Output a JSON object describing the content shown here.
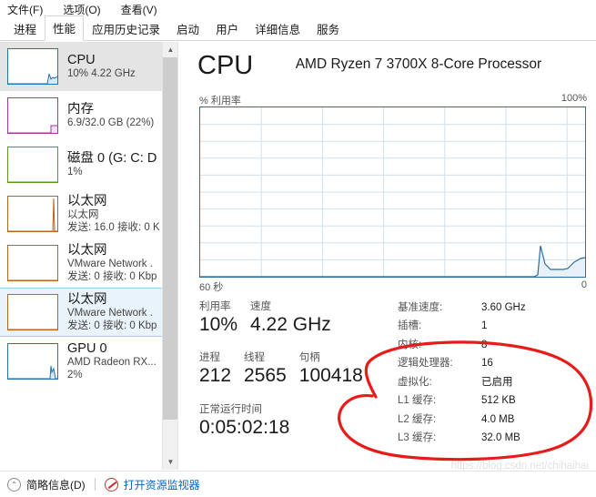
{
  "window": {
    "menu": [
      {
        "label": "文件(F)",
        "name": "menu-file"
      },
      {
        "label": "选项(O)",
        "name": "menu-options"
      },
      {
        "label": "查看(V)",
        "name": "menu-view"
      }
    ],
    "tabs": [
      {
        "label": "进程",
        "selected": false
      },
      {
        "label": "性能",
        "selected": true
      },
      {
        "label": "应用历史记录",
        "selected": false
      },
      {
        "label": "启动",
        "selected": false
      },
      {
        "label": "用户",
        "selected": false
      },
      {
        "label": "详细信息",
        "selected": false
      },
      {
        "label": "服务",
        "selected": false
      }
    ]
  },
  "sidebar": {
    "items": [
      {
        "title": "CPU",
        "sub1": "10% 4.22 GHz",
        "sub2": "",
        "color": "#2374ab",
        "state": "selected"
      },
      {
        "title": "内存",
        "sub1": "6.9/32.0 GB (22%)",
        "sub2": "",
        "color": "#a137a1",
        "state": "normal"
      },
      {
        "title": "磁盘 0 (G: C: D",
        "sub1": "1%",
        "sub2": "",
        "color": "#5b9822",
        "state": "normal"
      },
      {
        "title": "以太网",
        "sub1": "以太网",
        "sub2": "发送: 16.0 接收: 0 K",
        "color": "#b5651d",
        "state": "normal"
      },
      {
        "title": "以太网",
        "sub1": "VMware Network .",
        "sub2": "发送: 0 接收: 0 Kbp",
        "color": "#b5651d",
        "state": "normal"
      },
      {
        "title": "以太网",
        "sub1": "VMware Network .",
        "sub2": "发送: 0 接收: 0 Kbp",
        "color": "#b5651d",
        "state": "hover"
      },
      {
        "title": "GPU 0",
        "sub1": "AMD Radeon RX...",
        "sub2": "2%",
        "color": "#2374ab",
        "state": "normal"
      }
    ],
    "scrollbar": {
      "up": "▲",
      "down": "▼"
    }
  },
  "main": {
    "title": "CPU",
    "subtitle": "AMD Ryzen 7 3700X 8-Core Processor",
    "axis_label": "% 利用率",
    "axis_max": "100%",
    "time_left": "60 秒",
    "time_right": "0",
    "stats": {
      "row1": [
        {
          "label": "利用率",
          "value": "10%"
        },
        {
          "label": "速度",
          "value": "4.22 GHz"
        }
      ],
      "row2": [
        {
          "label": "进程",
          "value": "212"
        },
        {
          "label": "线程",
          "value": "2565"
        },
        {
          "label": "句柄",
          "value": "100418"
        }
      ],
      "row3": [
        {
          "label": "正常运行时间",
          "value": "0:05:02:18"
        }
      ]
    },
    "specs": [
      {
        "label": "基准速度:",
        "value": "3.60 GHz"
      },
      {
        "label": "插槽:",
        "value": "1"
      },
      {
        "label": "内核:",
        "value": "8"
      },
      {
        "label": "逻辑处理器:",
        "value": "16"
      },
      {
        "label": "虚拟化:",
        "value": "已启用"
      },
      {
        "label": "L1 缓存:",
        "value": "512 KB"
      },
      {
        "label": "L2 缓存:",
        "value": "4.0 MB"
      },
      {
        "label": "L3 缓存:",
        "value": "32.0 MB"
      }
    ]
  },
  "annotation": {
    "color": "#e81b1b"
  },
  "watermark": {
    "text": "https://blog.csdn.net/chihaihai"
  },
  "footer": {
    "summary_label": "简略信息(D)",
    "summary_chevron": "⌃",
    "resource_link": "打开资源监视器"
  },
  "chart_data": {
    "type": "area",
    "title": "CPU 利用率",
    "ylabel": "% 利用率",
    "xlabel": "60 秒",
    "ylim": [
      0,
      100
    ],
    "xlim": [
      0,
      60
    ],
    "grid": true,
    "grid_rows": 10,
    "grid_cols": 6,
    "x": [
      0,
      6,
      12,
      18,
      24,
      30,
      36,
      42,
      48,
      51,
      52,
      53,
      54,
      55,
      56,
      57,
      58,
      59,
      60
    ],
    "values": [
      0,
      0,
      0,
      0,
      0,
      0,
      0,
      0,
      0,
      0,
      1,
      8,
      18,
      12,
      8,
      6,
      6,
      7,
      12
    ]
  }
}
